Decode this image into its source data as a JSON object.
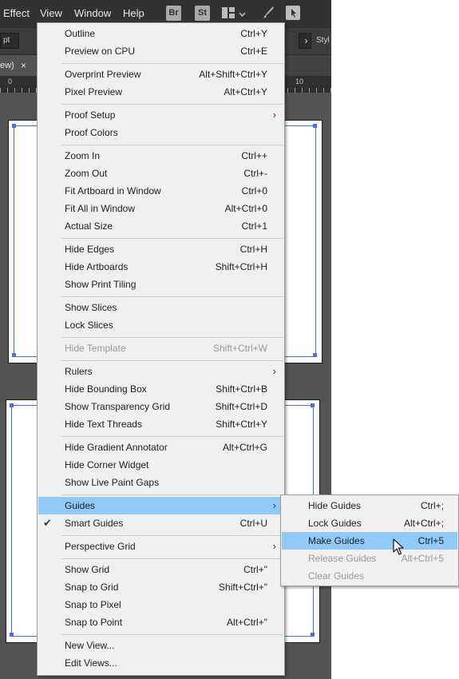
{
  "menubar": {
    "items": [
      "Effect",
      "View",
      "Window",
      "Help"
    ],
    "icons": [
      "Br",
      "St"
    ]
  },
  "control_bar": {
    "left_text": "pt",
    "right_text": "Styl"
  },
  "document_tab": {
    "title": "ew)",
    "close": "×"
  },
  "ruler": {
    "labels": [
      "0",
      "10"
    ]
  },
  "view_menu": {
    "items": [
      {
        "label": "Outline",
        "shortcut": "Ctrl+Y"
      },
      {
        "label": "Preview on CPU",
        "shortcut": "Ctrl+E"
      },
      {
        "label": "Overprint Preview",
        "shortcut": "Alt+Shift+Ctrl+Y"
      },
      {
        "label": "Pixel Preview",
        "shortcut": "Alt+Ctrl+Y"
      },
      {
        "label": "Proof Setup",
        "shortcut": "",
        "submenu": true
      },
      {
        "label": "Proof Colors",
        "shortcut": ""
      },
      {
        "label": "Zoom In",
        "shortcut": "Ctrl++"
      },
      {
        "label": "Zoom Out",
        "shortcut": "Ctrl+-"
      },
      {
        "label": "Fit Artboard in Window",
        "shortcut": "Ctrl+0"
      },
      {
        "label": "Fit All in Window",
        "shortcut": "Alt+Ctrl+0"
      },
      {
        "label": "Actual Size",
        "shortcut": "Ctrl+1"
      },
      {
        "label": "Hide Edges",
        "shortcut": "Ctrl+H"
      },
      {
        "label": "Hide Artboards",
        "shortcut": "Shift+Ctrl+H"
      },
      {
        "label": "Show Print Tiling",
        "shortcut": ""
      },
      {
        "label": "Show Slices",
        "shortcut": ""
      },
      {
        "label": "Lock Slices",
        "shortcut": ""
      },
      {
        "label": "Hide Template",
        "shortcut": "Shift+Ctrl+W",
        "disabled": true
      },
      {
        "label": "Rulers",
        "shortcut": "",
        "submenu": true
      },
      {
        "label": "Hide Bounding Box",
        "shortcut": "Shift+Ctrl+B"
      },
      {
        "label": "Show Transparency Grid",
        "shortcut": "Shift+Ctrl+D"
      },
      {
        "label": "Hide Text Threads",
        "shortcut": "Shift+Ctrl+Y"
      },
      {
        "label": "Hide Gradient Annotator",
        "shortcut": "Alt+Ctrl+G"
      },
      {
        "label": "Hide Corner Widget",
        "shortcut": ""
      },
      {
        "label": "Show Live Paint Gaps",
        "shortcut": ""
      },
      {
        "label": "Guides",
        "shortcut": "",
        "submenu": true,
        "highlighted": true
      },
      {
        "label": "Smart Guides",
        "shortcut": "Ctrl+U",
        "checked": true
      },
      {
        "label": "Perspective Grid",
        "shortcut": "",
        "submenu": true
      },
      {
        "label": "Show Grid",
        "shortcut": "Ctrl+\""
      },
      {
        "label": "Snap to Grid",
        "shortcut": "Shift+Ctrl+\""
      },
      {
        "label": "Snap to Pixel",
        "shortcut": ""
      },
      {
        "label": "Snap to Point",
        "shortcut": "Alt+Ctrl+\""
      },
      {
        "label": "New View...",
        "shortcut": ""
      },
      {
        "label": "Edit Views...",
        "shortcut": ""
      }
    ],
    "arrow_glyph": "›",
    "check_glyph": "✔"
  },
  "guides_submenu": {
    "items": [
      {
        "label": "Hide Guides",
        "shortcut": "Ctrl+;"
      },
      {
        "label": "Lock Guides",
        "shortcut": "Alt+Ctrl+;"
      },
      {
        "label": "Make Guides",
        "shortcut": "Ctrl+5",
        "highlighted": true
      },
      {
        "label": "Release Guides",
        "shortcut": "Alt+Ctrl+5",
        "disabled": true
      },
      {
        "label": "Clear Guides",
        "shortcut": "",
        "disabled": true
      }
    ]
  },
  "colors": {
    "menu_bg": "#f0f0f0",
    "highlight": "#91c9f7",
    "disabled_text": "#9a9a9a",
    "app_bg": "#535353",
    "guide_blue": "#4a6fe0"
  }
}
